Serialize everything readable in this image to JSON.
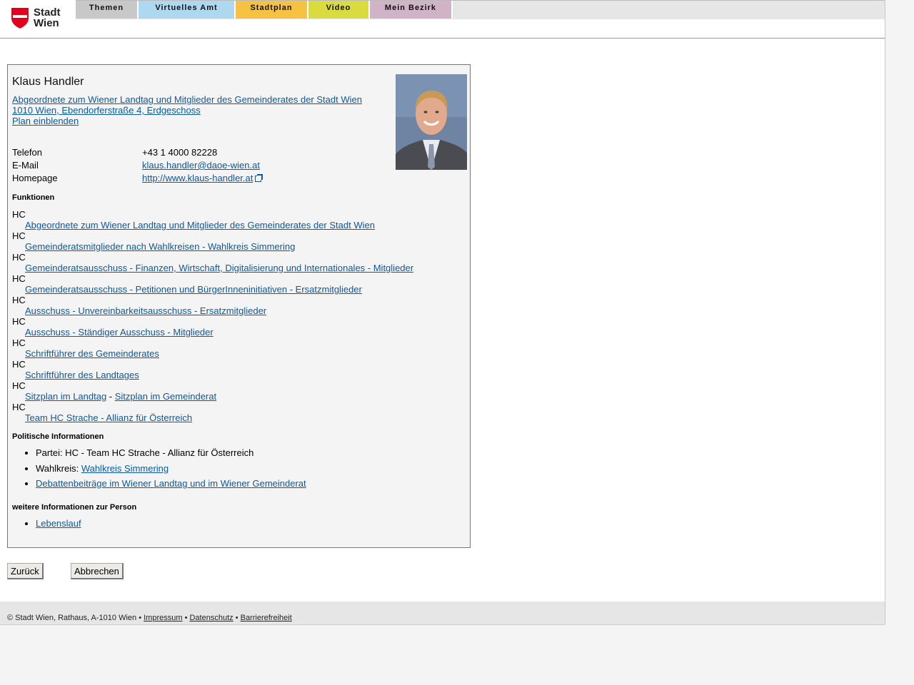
{
  "logo": {
    "line1": "Stadt",
    "line2": "Wien"
  },
  "nav": {
    "tabs": [
      {
        "label": "Themen",
        "color": "#c8c8c8"
      },
      {
        "label": "Virtuelles Amt",
        "color": "#add8f0"
      },
      {
        "label": "Stadtplan",
        "color": "#f5c242"
      },
      {
        "label": "Video",
        "color": "#dadb3e"
      },
      {
        "label": "Mein Bezirk",
        "color": "#d0b3c6"
      }
    ]
  },
  "person": {
    "name": "Klaus Handler",
    "affiliation": "Abgeordnete zum Wiener Landtag und Mitglieder des Gemeinderates der Stadt Wien",
    "address": "1010 Wien, Ebendorferstraße 4, Erdgeschoss",
    "plan_link": "Plan einblenden"
  },
  "contact": {
    "phone_label": "Telefon",
    "phone": "+43 1 4000 82228",
    "email_label": "E-Mail",
    "email": "klaus.handler@daoe-wien.at",
    "homepage_label": "Homepage",
    "homepage": "http://www.klaus-handler.at"
  },
  "functions": {
    "heading": "Funktionen",
    "items": [
      {
        "code": "HC",
        "link": "Abgeordnete zum Wiener Landtag und Mitglieder des Gemeinderates der Stadt Wien"
      },
      {
        "code": "HC",
        "link": "Gemeinderatsmitglieder nach Wahlkreisen - Wahlkreis Simmering"
      },
      {
        "code": "HC",
        "link": "Gemeinderatsausschuss - Finanzen, Wirtschaft, Digitalisierung und Internationales - Mitglieder"
      },
      {
        "code": "HC",
        "link": "Gemeinderatsausschuss - Petitionen und BürgerInneninitiativen - Ersatzmitglieder"
      },
      {
        "code": "HC",
        "link": "Ausschuss - Unvereinbarkeitsausschuss - Ersatzmitglieder"
      },
      {
        "code": "HC",
        "link": "Ausschuss - Ständiger Ausschuss - Mitglieder"
      },
      {
        "code": "HC",
        "link": "Schriftführer des Gemeinderates"
      },
      {
        "code": "HC",
        "link": "Schriftführer des Landtages"
      },
      {
        "code": "HC",
        "link": "Team HC Strache - Allianz für Österreich"
      }
    ],
    "seat": {
      "code": "HC",
      "landtag": "Sitzplan im Landtag",
      "sep": " - ",
      "gemeinderat": "Sitzplan im Gemeinderat"
    }
  },
  "political": {
    "heading": "Politische Informationen",
    "party": "Partei: HC - Team HC Strache - Allianz für Österreich",
    "district_label": "Wahlkreis: ",
    "district_link": "Wahlkreis Simmering",
    "debates_link": "Debattenbeiträge im Wiener Landtag und im Wiener Gemeinderat"
  },
  "more": {
    "heading": "weitere Informationen zur Person",
    "cv_link": "Lebenslauf"
  },
  "buttons": {
    "back": "Zurück",
    "cancel": "Abbrechen"
  },
  "footer": {
    "copyright": "© Stadt Wien, Rathaus, A-1010 Wien • ",
    "impressum": "Impressum",
    "sep": " • ",
    "datenschutz": "Datenschutz",
    "barrierefreiheit": "Barrierefreiheit"
  }
}
